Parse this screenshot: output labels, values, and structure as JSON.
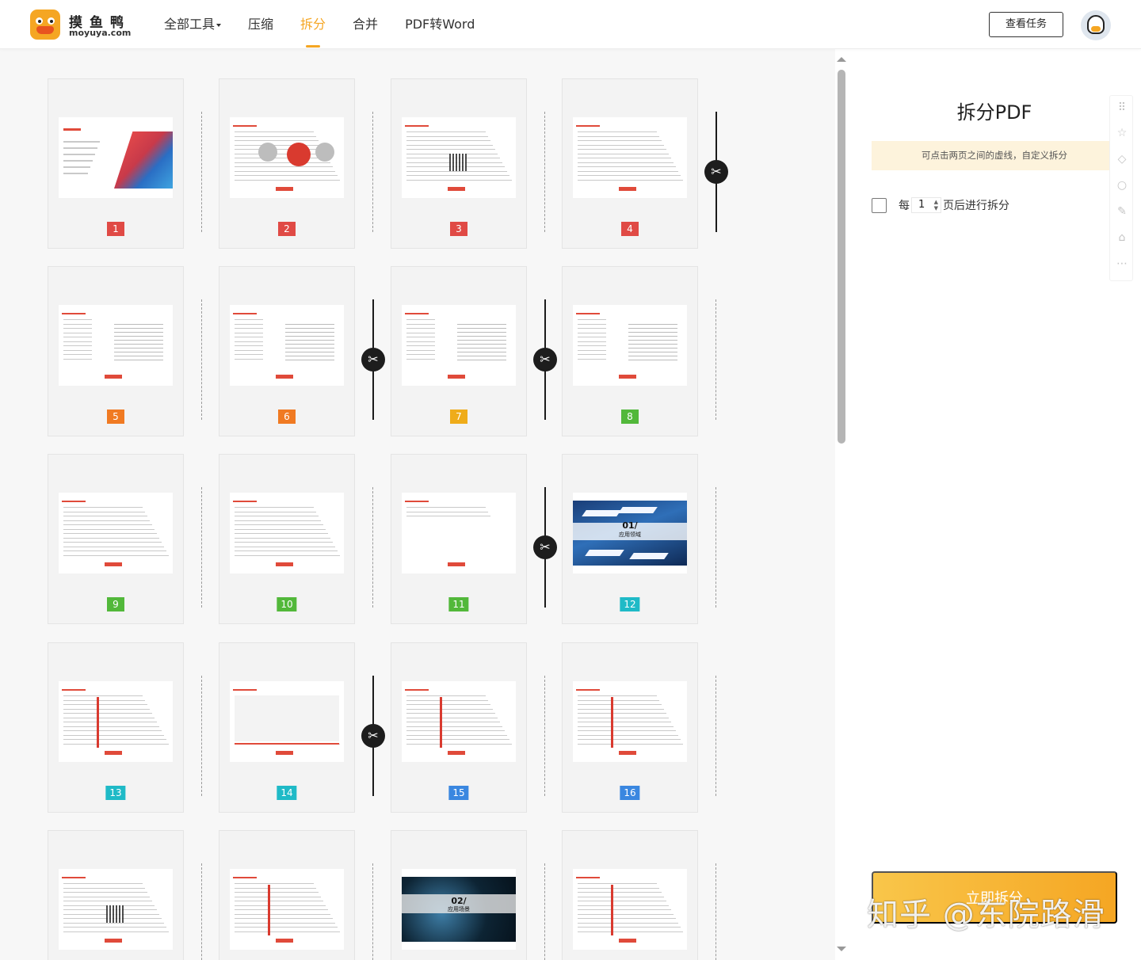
{
  "header": {
    "brand_name": "摸鱼鸭",
    "brand_url": "moyuya.com",
    "nav": [
      {
        "label": "全部工具"
      },
      {
        "label": "压缩"
      },
      {
        "label": "拆分"
      },
      {
        "label": "合并"
      },
      {
        "label": "PDF转Word"
      }
    ],
    "active_nav": "拆分",
    "task_button": "查看任务"
  },
  "pages": [
    {
      "num": "1",
      "badge_color": "#e04a45",
      "kind": "cover"
    },
    {
      "num": "2",
      "badge_color": "#e04a45",
      "kind": "circles"
    },
    {
      "num": "3",
      "badge_color": "#e04a45",
      "kind": "qr-text"
    },
    {
      "num": "4",
      "badge_color": "#e04a45",
      "kind": "text"
    },
    {
      "num": "5",
      "badge_color": "#f07a22",
      "kind": "toc"
    },
    {
      "num": "6",
      "badge_color": "#f07a22",
      "kind": "toc"
    },
    {
      "num": "7",
      "badge_color": "#efac1a",
      "kind": "toc"
    },
    {
      "num": "8",
      "badge_color": "#52b83a",
      "kind": "toc"
    },
    {
      "num": "9",
      "badge_color": "#52b83a",
      "kind": "text"
    },
    {
      "num": "10",
      "badge_color": "#52b83a",
      "kind": "text"
    },
    {
      "num": "11",
      "badge_color": "#52b83a",
      "kind": "sparse"
    },
    {
      "num": "12",
      "badge_color": "#1fbac7",
      "kind": "section-blue",
      "slide_number": "01/",
      "slide_caption": "应用领域"
    },
    {
      "num": "13",
      "badge_color": "#1fbac7",
      "kind": "grid"
    },
    {
      "num": "14",
      "badge_color": "#1fbac7",
      "kind": "map"
    },
    {
      "num": "15",
      "badge_color": "#3a87e0",
      "kind": "table"
    },
    {
      "num": "16",
      "badge_color": "#3a87e0",
      "kind": "table"
    },
    {
      "num": "",
      "badge_color": "#3a87e0",
      "kind": "qr-text"
    },
    {
      "num": "",
      "badge_color": "#3a87e0",
      "kind": "grid"
    },
    {
      "num": "",
      "badge_color": "#3a87e0",
      "kind": "section-dark",
      "slide_number": "02/",
      "slide_caption": "应用场景"
    },
    {
      "num": "",
      "badge_color": "#3a87e0",
      "kind": "table"
    }
  ],
  "separators_cut": [
    [
      false,
      false,
      false,
      true
    ],
    [
      false,
      true,
      true,
      false
    ],
    [
      false,
      false,
      true,
      false
    ],
    [
      false,
      true,
      false,
      false
    ],
    [
      false,
      false,
      false,
      false
    ]
  ],
  "side_tools": [
    "apps-icon",
    "star-icon",
    "tag-icon",
    "comment-icon",
    "pen-icon",
    "home-icon",
    "more-icon"
  ],
  "panel": {
    "title": "拆分PDF",
    "hint": "可点击两页之间的虚线，自定义拆分",
    "option_prefix": "每",
    "option_value": "1",
    "option_suffix": "页后进行拆分",
    "split_button": "立即拆分"
  },
  "watermark": "知乎 @东院路滑"
}
